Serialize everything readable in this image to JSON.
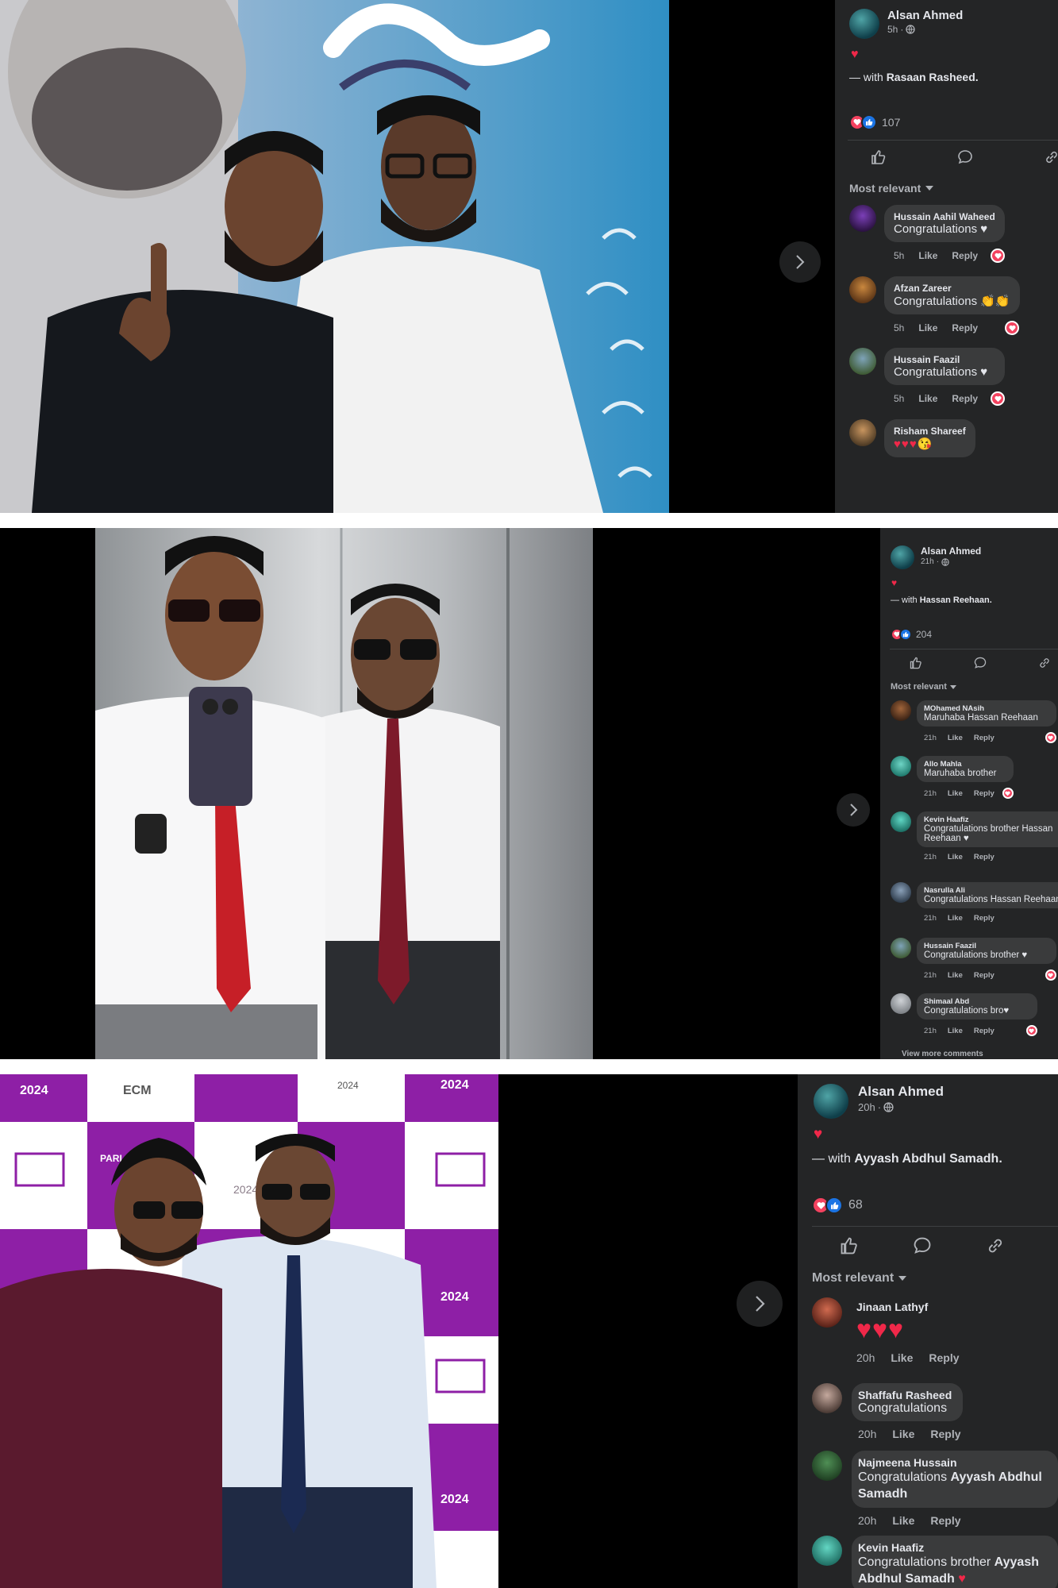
{
  "post1": {
    "author": "Alsan Ahmed",
    "time": "5h",
    "privacy_icon": "globe-icon",
    "caption_emoji": "♥",
    "with_prefix": "— with",
    "with_name": "Rasaan Rasheed.",
    "reaction_count": "107",
    "sort_label": "Most relevant",
    "comments": [
      {
        "name": "Hussain Aahil Waheed",
        "text": "Congratulations ♥",
        "time": "5h",
        "like": "Like",
        "reply": "Reply",
        "loved": true
      },
      {
        "name": "Afzan Zareer",
        "text": "Congratulations 👏👏",
        "time": "5h",
        "like": "Like",
        "reply": "Reply",
        "loved": true
      },
      {
        "name": "Hussain Faazil",
        "text": "Congratulations ♥",
        "time": "5h",
        "like": "Like",
        "reply": "Reply",
        "loved": true
      },
      {
        "name": "Risham Shareef",
        "text": "♥♥♥😘",
        "time": "",
        "like": "",
        "reply": "",
        "loved": false
      }
    ]
  },
  "post2": {
    "author": "Alsan Ahmed",
    "time": "21h",
    "privacy_icon": "globe-icon",
    "caption_emoji": "♥",
    "with_prefix": "— with",
    "with_name": "Hassan Reehaan.",
    "reaction_count": "204",
    "sort_label": "Most relevant",
    "view_more": "View more comments",
    "comments": [
      {
        "name": "MOhamed NAsih",
        "text": "Maruhaba Hassan Reehaan",
        "time": "21h",
        "like": "Like",
        "reply": "Reply",
        "loved": true
      },
      {
        "name": "Allo Mahla",
        "text": "Maruhaba brother",
        "time": "21h",
        "like": "Like",
        "reply": "Reply",
        "loved": true
      },
      {
        "name": "Kevin Haafiz",
        "text": "Congratulations brother Hassan Reehaan ♥",
        "time": "21h",
        "like": "Like",
        "reply": "Reply",
        "loved": false
      },
      {
        "name": "Nasrulla Ali",
        "text": "Congratulations Hassan Reehaan",
        "time": "21h",
        "like": "Like",
        "reply": "Reply",
        "loved": false
      },
      {
        "name": "Hussain Faazil",
        "text": "Congratulations brother ♥",
        "time": "21h",
        "like": "Like",
        "reply": "Reply",
        "loved": true
      },
      {
        "name": "Shimaal Abd",
        "text": "Congratulations bro♥",
        "time": "21h",
        "like": "Like",
        "reply": "Reply",
        "loved": true
      }
    ]
  },
  "post3": {
    "author": "Alsan Ahmed",
    "time": "20h",
    "privacy_icon": "globe-icon",
    "caption_emoji": "♥",
    "with_prefix": "— with",
    "with_name": "Ayyash Abdhul Samadh.",
    "reaction_count": "68",
    "sort_label": "Most relevant",
    "comments": [
      {
        "name": "Jinaan Lathyf",
        "text": "♥♥♥",
        "time": "20h",
        "like": "Like",
        "reply": "Reply",
        "loved": false
      },
      {
        "name": "Shaffafu Rasheed",
        "text": "Congratulations",
        "time": "20h",
        "like": "Like",
        "reply": "Reply",
        "loved": false
      },
      {
        "name": "Najmeena Hussain",
        "text_prefix": "Congratulations ",
        "text_bold": "Ayyash Abdhul Samadh",
        "time": "20h",
        "like": "Like",
        "reply": "Reply",
        "loved": false
      },
      {
        "name": "Kevin Haafiz",
        "text_prefix": "Congratulations brother ",
        "text_bold": "Ayyash Abdhul Samadh",
        "text_suffix": " ♥",
        "time": "",
        "like": "",
        "reply": "",
        "loved": false
      }
    ],
    "banner": {
      "years": [
        "2024",
        "2024",
        "2024",
        "2024",
        "2024",
        "2024"
      ],
      "ecm": "ECM",
      "title": "PARLIAMENTARY ELECTION"
    }
  },
  "colors": {
    "panel_bg": "#000000",
    "sidebar_bg": "#242526",
    "bubble_bg": "#3a3b3c",
    "text_primary": "#e4e6eb",
    "text_secondary": "#b0b3b8",
    "love": "#f3425f",
    "like": "#1b74e4",
    "banner_purple": "#8e1fa6"
  }
}
